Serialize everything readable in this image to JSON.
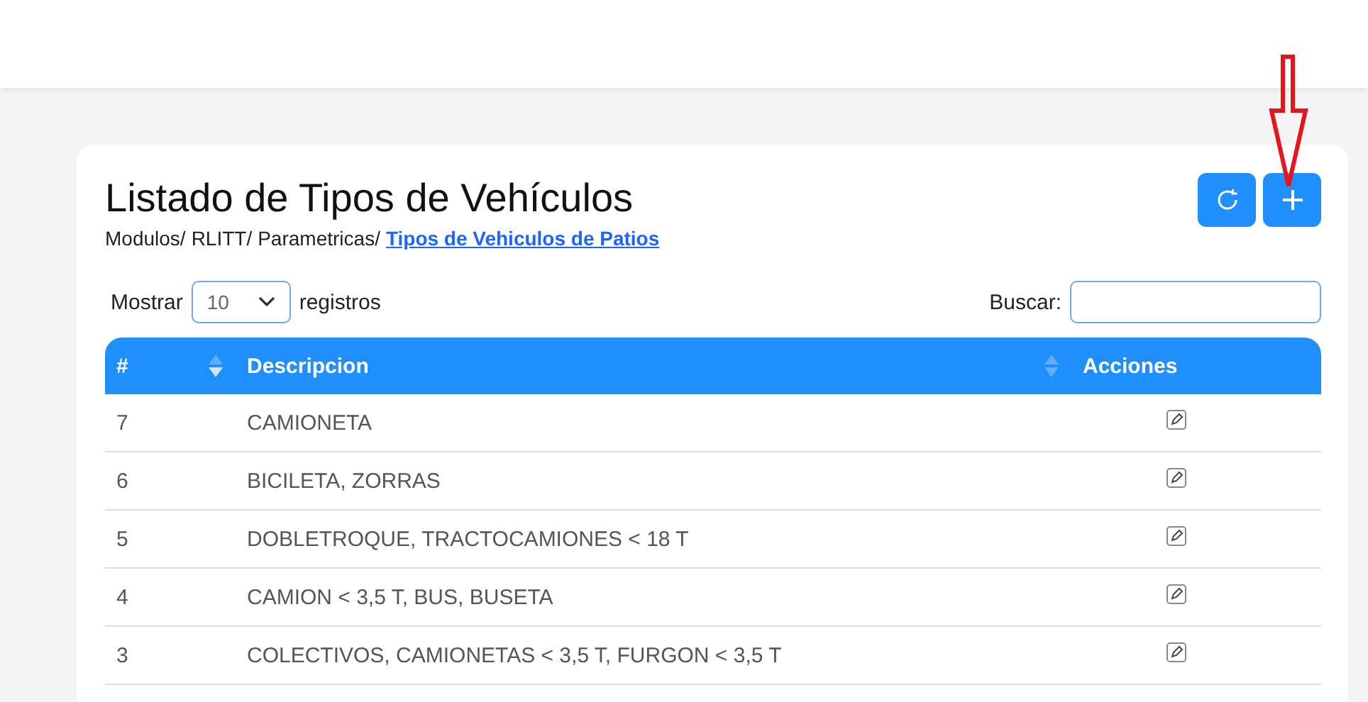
{
  "page": {
    "title": "Listado de Tipos de Vehículos",
    "breadcrumb": [
      "Modulos/",
      "RLITT/",
      "Parametricas/"
    ],
    "breadcrumb_current": "Tipos de Vehiculos de Patios"
  },
  "toolbar": {
    "annotation_arrow": true
  },
  "length_control": {
    "before": "Mostrar",
    "value": "10",
    "after": "registros"
  },
  "search": {
    "label": "Buscar:"
  },
  "table": {
    "columns": [
      {
        "label": "#",
        "sorted": true
      },
      {
        "label": "Descripcion",
        "sorted": false
      },
      {
        "label": "Acciones"
      }
    ],
    "rows": [
      {
        "id": "7",
        "description": "CAMIONETA"
      },
      {
        "id": "6",
        "description": "BICILETA, ZORRAS"
      },
      {
        "id": "5",
        "description": "DOBLETROQUE, TRACTOCAMIONES < 18 T"
      },
      {
        "id": "4",
        "description": "CAMION < 3,5 T, BUS, BUSETA"
      },
      {
        "id": "3",
        "description": "COLECTIVOS, CAMIONETAS < 3,5 T, FURGON < 3,5 T"
      }
    ]
  }
}
